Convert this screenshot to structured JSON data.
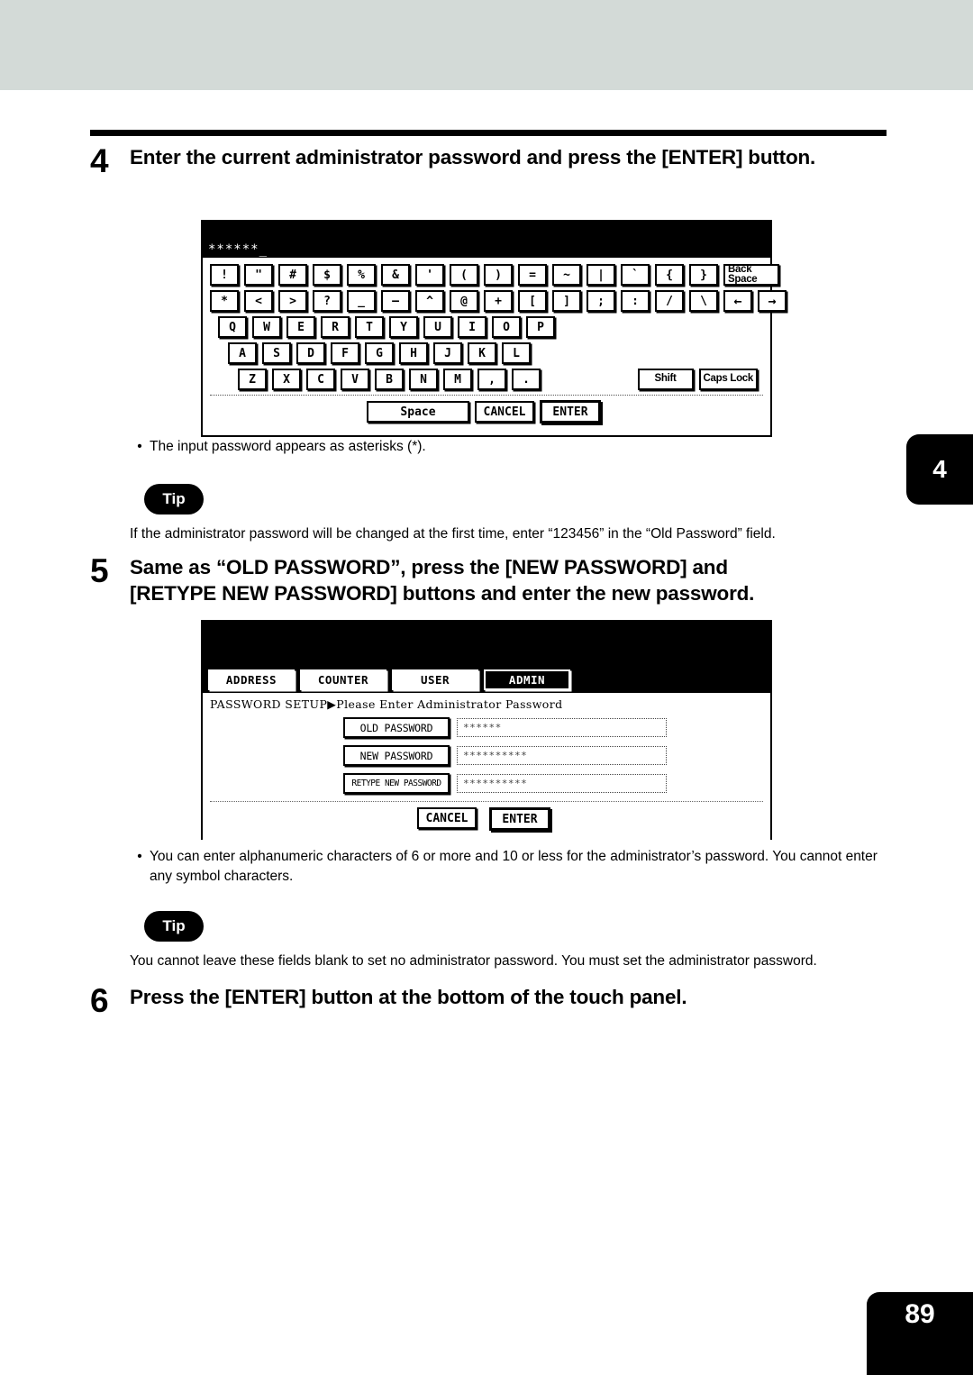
{
  "page": {
    "number": "89",
    "side_tab": "4"
  },
  "step4": {
    "number": "4",
    "text": "Enter the current administrator password and press the [ENTER] button."
  },
  "keyboard_screen": {
    "entry_display": "******_",
    "row1": [
      "!",
      "\"",
      "#",
      "$",
      "%",
      "&",
      "'",
      "(",
      ")",
      "=",
      "~",
      "|",
      "`",
      "{",
      "}"
    ],
    "row1_special": "Back Space",
    "row2": [
      "*",
      "<",
      ">",
      "?",
      "_",
      "—",
      "^",
      "@",
      "+",
      "[",
      "]",
      ";",
      ":",
      "/",
      "\\"
    ],
    "row2_special": [
      "←",
      "→"
    ],
    "row3": [
      "Q",
      "W",
      "E",
      "R",
      "T",
      "Y",
      "U",
      "I",
      "O",
      "P"
    ],
    "row4": [
      "A",
      "S",
      "D",
      "F",
      "G",
      "H",
      "J",
      "K",
      "L"
    ],
    "row5": [
      "Z",
      "X",
      "C",
      "V",
      "B",
      "N",
      "M",
      ",",
      "."
    ],
    "row5_special": [
      "Shift",
      "Caps Lock"
    ],
    "bottom": [
      "Space",
      "CANCEL",
      "ENTER"
    ]
  },
  "note1": {
    "bullet": "•",
    "text": "The input password appears as asterisks (*)."
  },
  "tip1": {
    "badge": "Tip",
    "text": "If the administrator password will be changed at the first time, enter “123456” in the “Old Password” field."
  },
  "step5": {
    "number": "5",
    "line1": "Same as “OLD PASSWORD”, press the [NEW PASSWORD] and",
    "line2": "[RETYPE NEW PASSWORD] buttons and enter the new password."
  },
  "admin_screen": {
    "tabs": [
      {
        "label": "ADDRESS",
        "selected": false
      },
      {
        "label": "COUNTER",
        "selected": false
      },
      {
        "label": "USER",
        "selected": false
      },
      {
        "label": "ADMIN",
        "selected": true
      }
    ],
    "section_label": "PASSWORD SETUP",
    "prompt": "▶Please Enter Administrator Password",
    "fields": [
      {
        "button": "OLD PASSWORD",
        "value": "******"
      },
      {
        "button": "NEW PASSWORD",
        "value": "**********"
      },
      {
        "button": "RETYPE NEW PASSWORD",
        "value": "**********"
      }
    ],
    "footer": [
      "CANCEL",
      "ENTER"
    ]
  },
  "note2": {
    "bullet": "•",
    "text": "You can enter alphanumeric characters of 6 or more and 10 or less for the administrator’s password.  You cannot enter any symbol characters."
  },
  "tip2": {
    "badge": "Tip",
    "text": "You cannot leave these fields blank to set no administrator password.  You must set the administrator password."
  },
  "step6": {
    "number": "6",
    "text": "Press the [ENTER] button at the bottom of the touch panel."
  }
}
